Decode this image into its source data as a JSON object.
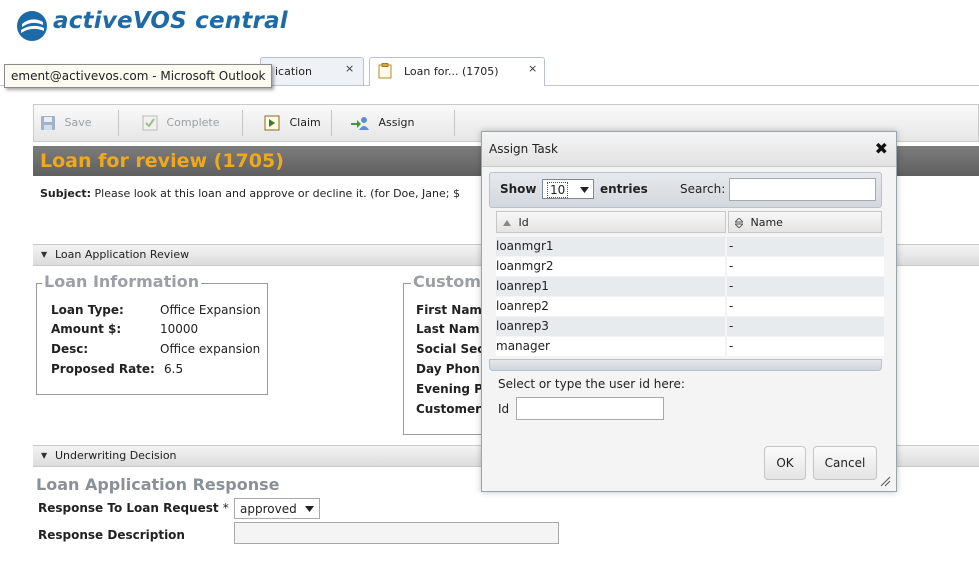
{
  "app": {
    "title": "activeVOS central"
  },
  "tooltip": {
    "text": "ement@activevos.com - Microsoft Outlook"
  },
  "tabs": [
    {
      "label": "ication",
      "close": "×"
    },
    {
      "label": "Loan for... (1705)",
      "close": "×"
    }
  ],
  "toolbar": {
    "save": "Save",
    "complete": "Complete",
    "claim": "Claim",
    "assign": "Assign"
  },
  "task": {
    "title": "Loan for review (1705)",
    "subject_label": "Subject:",
    "subject_text": "Please look at this loan and approve or decline it. (for Doe, Jane; $"
  },
  "sections": {
    "review": "Loan Application Review",
    "underwriting": "Underwriting Decision"
  },
  "loan_info": {
    "legend": "Loan Information",
    "rows": [
      {
        "label": "Loan Type:",
        "value": "Office Expansion"
      },
      {
        "label": "Amount $:",
        "value": "10000"
      },
      {
        "label": "Desc:",
        "value": "Office expansion"
      },
      {
        "label": "Proposed Rate:",
        "value": "6.5"
      }
    ]
  },
  "customer_info": {
    "legend": "Custom",
    "rows": [
      "First Nam",
      "Last Nam",
      "Social Sec",
      "Day Phon",
      "Evening P",
      "Customer"
    ]
  },
  "response": {
    "title": "Loan Application Response",
    "request_label": "Response To Loan Request",
    "required_mark": "*",
    "request_value": "approved",
    "description_label": "Response Description",
    "description_value": ""
  },
  "modal": {
    "title": "Assign Task",
    "close": "✖",
    "show_label": "Show",
    "show_value": "10",
    "entries_label": "entries",
    "search_label": "Search:",
    "search_value": "",
    "columns": [
      "Id",
      "Name"
    ],
    "rows": [
      {
        "id": "loanmgr1",
        "name": "-"
      },
      {
        "id": "loanmgr2",
        "name": "-"
      },
      {
        "id": "loanrep1",
        "name": "-"
      },
      {
        "id": "loanrep2",
        "name": "-"
      },
      {
        "id": "loanrep3",
        "name": "-"
      },
      {
        "id": "manager",
        "name": "-"
      }
    ],
    "prompt": "Select or type the user id here:",
    "id_label": "Id",
    "id_value": "",
    "ok": "OK",
    "cancel": "Cancel"
  },
  "icons": {
    "logo": "activevos-logo-icon",
    "save": "floppy-disk-icon",
    "complete": "check-box-icon",
    "claim": "claim-flag-icon",
    "assign": "assign-users-icon",
    "tab": "clipboard-icon",
    "dropdown": "chevron-down-icon",
    "sort_asc": "sort-ascending-icon",
    "sort_both": "sort-both-icon",
    "resize": "resize-grip-icon"
  },
  "colors": {
    "brand": "#1e6aa7",
    "title_accent": "#f0a81c",
    "title_bar": "#6b6b6b"
  }
}
